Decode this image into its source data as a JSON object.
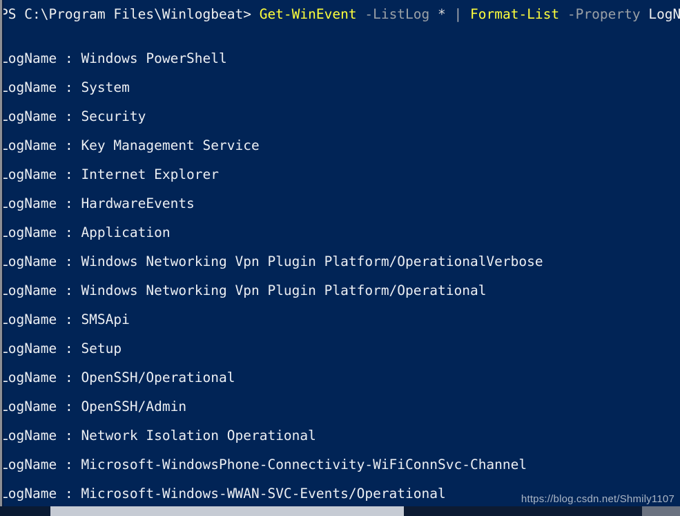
{
  "window": {
    "background_color": "#012456",
    "foreground_color": "#eceff3"
  },
  "prompt": {
    "path": "PS C:\\Program Files\\Winlogbeat>",
    "command_1": "Get-WinEvent",
    "param_1": "-ListLog",
    "star": "*",
    "pipe": "|",
    "command_2": "Format-List",
    "param_2": "-Property",
    "arg_2": "LogName",
    "accent_command_color": "#ffff3b",
    "param_color": "#9aa0a6"
  },
  "output": {
    "key_label": "LogName",
    "separator": ":",
    "rows": [
      {
        "key": "LogName",
        "sep": ":",
        "value": "Windows PowerShell"
      },
      {
        "key": "LogName",
        "sep": ":",
        "value": "System"
      },
      {
        "key": "LogName",
        "sep": ":",
        "value": "Security"
      },
      {
        "key": "LogName",
        "sep": ":",
        "value": "Key Management Service"
      },
      {
        "key": "LogName",
        "sep": ":",
        "value": "Internet Explorer"
      },
      {
        "key": "LogName",
        "sep": ":",
        "value": "HardwareEvents"
      },
      {
        "key": "LogName",
        "sep": ":",
        "value": "Application"
      },
      {
        "key": "LogName",
        "sep": ":",
        "value": "Windows Networking Vpn Plugin Platform/OperationalVerbose"
      },
      {
        "key": "LogName",
        "sep": ":",
        "value": "Windows Networking Vpn Plugin Platform/Operational"
      },
      {
        "key": "LogName",
        "sep": ":",
        "value": "SMSApi"
      },
      {
        "key": "LogName",
        "sep": ":",
        "value": "Setup"
      },
      {
        "key": "LogName",
        "sep": ":",
        "value": "OpenSSH/Operational"
      },
      {
        "key": "LogName",
        "sep": ":",
        "value": "OpenSSH/Admin"
      },
      {
        "key": "LogName",
        "sep": ":",
        "value": "Network Isolation Operational"
      },
      {
        "key": "LogName",
        "sep": ":",
        "value": "Microsoft-WindowsPhone-Connectivity-WiFiConnSvc-Channel"
      },
      {
        "key": "LogName",
        "sep": ":",
        "value": "Microsoft-Windows-WWAN-SVC-Events/Operational"
      }
    ]
  },
  "watermark": {
    "text": "https://blog.csdn.net/Shmily1107"
  },
  "scrollbar": {
    "orientation": "horizontal",
    "thumb_color": "#c6cbd4"
  }
}
